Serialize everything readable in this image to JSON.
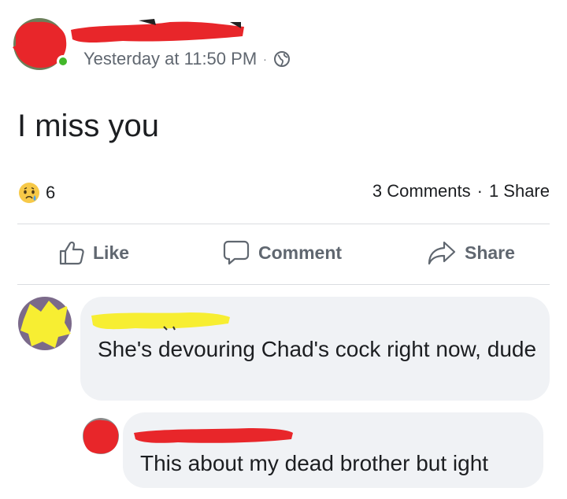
{
  "post": {
    "timestamp": "Yesterday at 11:50 PM",
    "separator": "·",
    "privacy_icon": "globe-icon",
    "text": "I miss you"
  },
  "reactions": {
    "icon": "sad-reaction-icon",
    "count": "6"
  },
  "stats": {
    "comments": "3 Comments",
    "separator": "·",
    "shares": "1 Share"
  },
  "actions": {
    "like": "Like",
    "comment": "Comment",
    "share": "Share"
  },
  "comments": [
    {
      "text": "She's devouring Chad's cock right now, dude"
    },
    {
      "text": "This about my dead brother but ight"
    }
  ],
  "colors": {
    "redact_red": "#e8262a",
    "redact_yellow": "#f7ee32",
    "online_green": "#42b72a",
    "meta_gray": "#606770",
    "bubble_bg": "#f0f2f5"
  }
}
